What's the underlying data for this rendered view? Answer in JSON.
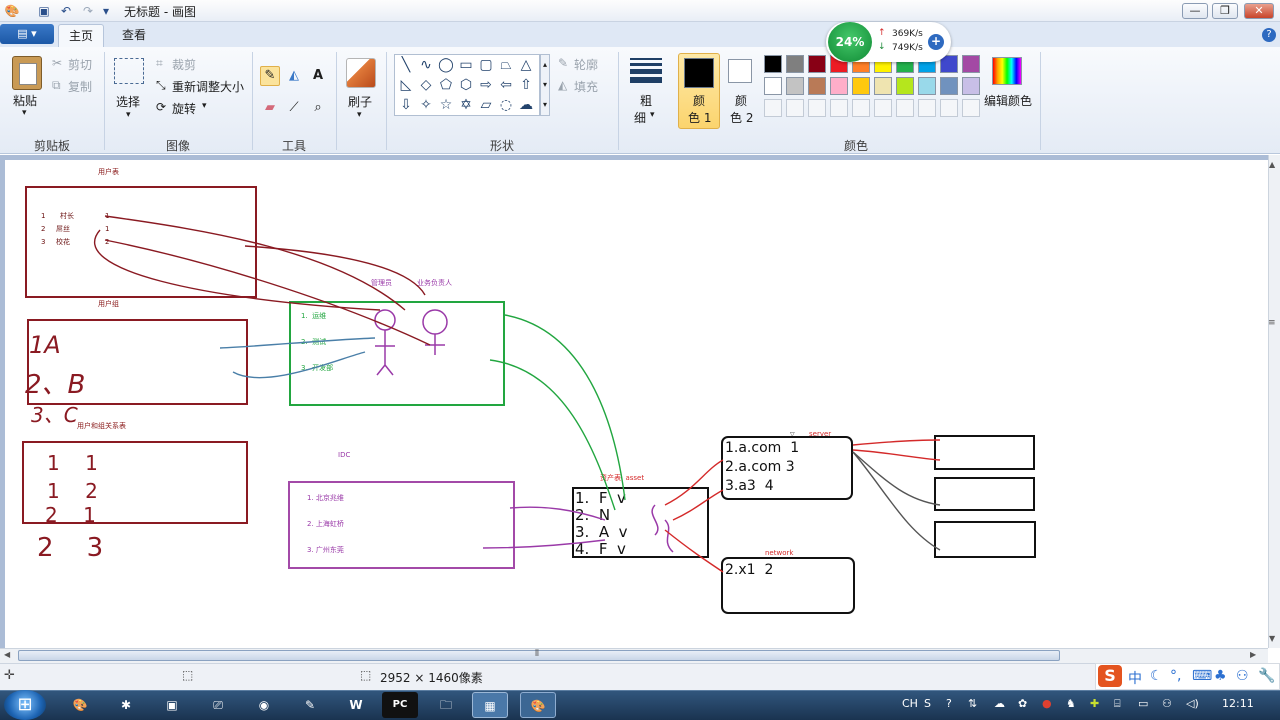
{
  "window": {
    "title": "无标题 - 画图",
    "min_label": "—",
    "max_label": "❐",
    "close_label": "✕"
  },
  "tabs": {
    "file_label": "▤ ▾",
    "home": "主页",
    "view": "查看"
  },
  "help_label": "?",
  "clipboard": {
    "paste": "粘贴",
    "cut": "剪切",
    "copy": "复制",
    "group": "剪贴板"
  },
  "image": {
    "select": "选择",
    "crop": "裁剪",
    "resize": "重新调整大小",
    "rotate": "旋转",
    "group": "图像"
  },
  "tools": {
    "group": "工具"
  },
  "brushes": {
    "label": "刷子"
  },
  "shapes": {
    "outline": "轮廓",
    "fill": "填充",
    "group": "形状"
  },
  "size": {
    "label_1": "粗",
    "label_2": "细"
  },
  "colors": {
    "color1_line1": "颜",
    "color1_line2": "色 1",
    "color2_line1": "颜",
    "color2_line2": "色 2",
    "edit": "编辑颜色",
    "group": "颜色",
    "color1": "#000000",
    "color2": "#ffffff",
    "palette_row1": [
      "#000000",
      "#7f7f7f",
      "#880015",
      "#ed1c24",
      "#ff7f27",
      "#fff200",
      "#22b14c",
      "#00a2e8",
      "#3f48cc",
      "#a349a4"
    ],
    "palette_row2": [
      "#ffffff",
      "#c3c3c3",
      "#b97a57",
      "#ffaec9",
      "#ffc90e",
      "#efe4b0",
      "#b5e61d",
      "#99d9ea",
      "#7092be",
      "#c8bfe7"
    ]
  },
  "netmonitor": {
    "percent": "24%",
    "up": "369K/s",
    "down": "749K/s"
  },
  "drawing": {
    "user_table": {
      "title": "用户表",
      "rows": [
        {
          "id": "1",
          "name": "村长",
          "group": "1"
        },
        {
          "id": "2",
          "name": "屌丝",
          "group": "1"
        },
        {
          "id": "3",
          "name": "校花",
          "group": "2"
        }
      ]
    },
    "user_group": {
      "title": "用户组",
      "row1": "1A",
      "row2": "2、B",
      "row3": "3、C"
    },
    "user_group_rel": {
      "title": "用户和组关系表",
      "row1": "1    1",
      "row2": "1    2",
      "row3": "2    1",
      "row4": "2    3"
    },
    "depts": {
      "items": [
        "1.  运维",
        "2.  测试",
        "3.  开发部"
      ],
      "label_admin": "管理员",
      "label_owner": "业务负责人"
    },
    "idc": {
      "title": "IDC",
      "items": [
        "1. 北京兆维",
        "2. 上海虹桥",
        "3. 广州东莞"
      ]
    },
    "asset": {
      "title": "资产表  asset",
      "rows": [
        "1.  F  v",
        "2.  N",
        "3.  A  v",
        "4.  F  v"
      ]
    },
    "server": {
      "title": "server",
      "rows": [
        "1.a.com  1",
        "2.a.com 3",
        "3.a3  4"
      ]
    },
    "network": {
      "title": "network",
      "rows": [
        "2.x1  2"
      ]
    }
  },
  "status": {
    "dimensions": "2952 × 1460像素"
  },
  "taskbar": {
    "start": "⊞",
    "clock": "12:11",
    "lang": "CH"
  },
  "ime": {
    "logo": "S",
    "mode": "中"
  }
}
